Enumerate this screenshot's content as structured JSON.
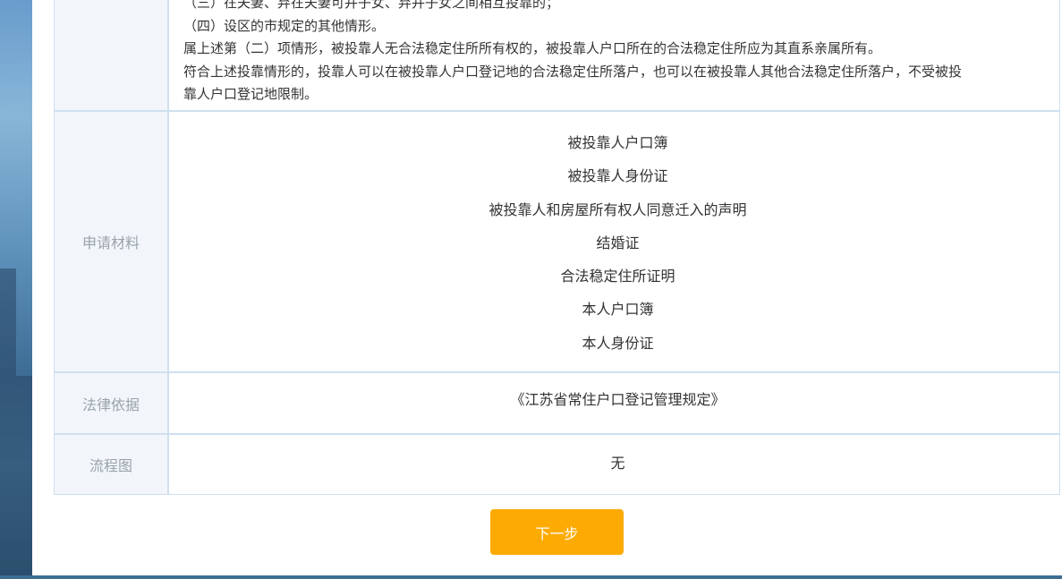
{
  "conditions": {
    "lines": [
      "（三）在夫妻、弃在夫妻可并子女、弃并子女之间相互投靠的；",
      "（四）设区的市规定的其他情形。",
      "属上述第（二）项情形，被投靠人无合法稳定住所所有权的，被投靠人户口所在的合法稳定住所应为其直系亲属所有。",
      "符合上述投靠情形的，投靠人可以在被投靠人户口登记地的合法稳定住所落户，也可以在被投靠人其他合法稳定住所落户，不受被投",
      "靠人户口登记地限制。"
    ]
  },
  "materials": {
    "label": "申请材料",
    "items": [
      "被投靠人户口簿",
      "被投靠人身份证",
      "被投靠人和房屋所有权人同意迁入的声明",
      "结婚证",
      "合法稳定住所证明",
      "本人户口簿",
      "本人身份证"
    ]
  },
  "legal_basis": {
    "label": "法律依据",
    "value": "《江苏省常住户口登记管理规定》"
  },
  "flowchart": {
    "label": "流程图",
    "value": "无"
  },
  "next_button": {
    "label": "下一步"
  },
  "colors": {
    "accent": "#fdab03",
    "border": "#cfe0ef",
    "label_bg": "#f2f6fa"
  }
}
